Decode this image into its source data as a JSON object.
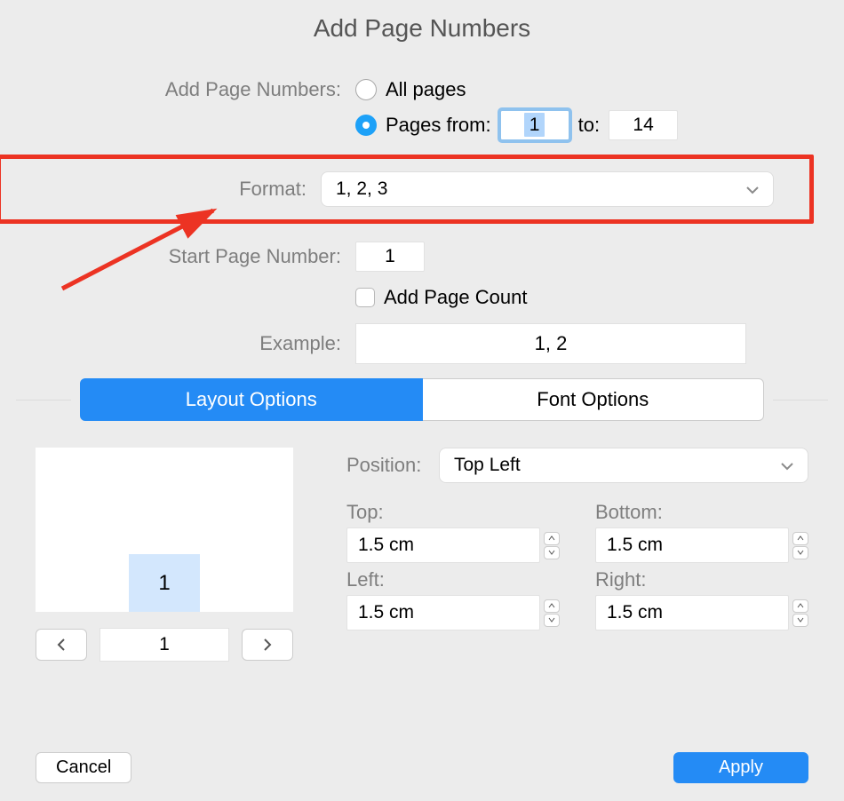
{
  "title": "Add Page Numbers",
  "range": {
    "label": "Add Page Numbers:",
    "option_all": "All pages",
    "option_range": "Pages from:",
    "from_value": "1",
    "to_label": "to:",
    "to_value": "14",
    "selected": "range"
  },
  "format": {
    "label": "Format:",
    "value": "1, 2, 3"
  },
  "start": {
    "label": "Start Page Number:",
    "value": "1"
  },
  "addcount": {
    "label": "Add Page Count"
  },
  "example": {
    "label": "Example:",
    "value": "1, 2"
  },
  "tabs": {
    "layout": "Layout Options",
    "font": "Font Options",
    "active": "layout"
  },
  "preview": {
    "page_number": "1",
    "current": "1"
  },
  "position": {
    "label": "Position:",
    "value": "Top Left"
  },
  "margins": {
    "top": {
      "label": "Top:",
      "value": "1.5 cm"
    },
    "bottom": {
      "label": "Bottom:",
      "value": "1.5 cm"
    },
    "left": {
      "label": "Left:",
      "value": "1.5 cm"
    },
    "right": {
      "label": "Right:",
      "value": "1.5 cm"
    }
  },
  "buttons": {
    "cancel": "Cancel",
    "apply": "Apply"
  }
}
